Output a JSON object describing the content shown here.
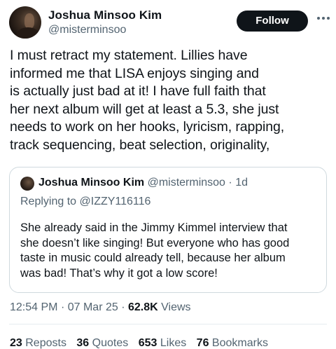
{
  "author": {
    "name": "Joshua Minsoo Kim",
    "handle": "@misterminsoo",
    "follow_label": "Follow"
  },
  "tweet": {
    "lines": [
      "I must retract my statement. Lillies have",
      "informed me that LISA enjoys singing and",
      "is actually just bad at it! I have full faith that",
      "her next album will get at least a 5.3, she just",
      "needs to work on her hooks, lyricism, rapping,",
      "track sequencing, beat selection, originality,"
    ]
  },
  "quote": {
    "name": "Joshua Minsoo Kim",
    "handle": "@misterminsoo",
    "separator": "·",
    "time": "1d",
    "replying_prefix": "Replying to",
    "replying_to": "@IZZY116116",
    "lines": [
      "She already said in the Jimmy Kimmel interview that",
      "she doesn’t like singing! But everyone who has good",
      "taste in music could already tell, because her album",
      "was bad! That’s why it got a low score!"
    ]
  },
  "meta": {
    "time": "12:54 PM",
    "separator": "·",
    "date": "07 Mar 25",
    "views_count": "62.8K",
    "views_label": "Views"
  },
  "stats": [
    {
      "count": "23",
      "label": "Reposts"
    },
    {
      "count": "36",
      "label": "Quotes"
    },
    {
      "count": "653",
      "label": "Likes"
    },
    {
      "count": "76",
      "label": "Bookmarks"
    }
  ],
  "icons": {
    "avatar": "profile-photo",
    "more": "more-horizontal-icon"
  },
  "colors": {
    "text_primary": "#0f1419",
    "text_secondary": "#536471",
    "border": "#cfd9de",
    "follow_bg": "#0f1419"
  }
}
